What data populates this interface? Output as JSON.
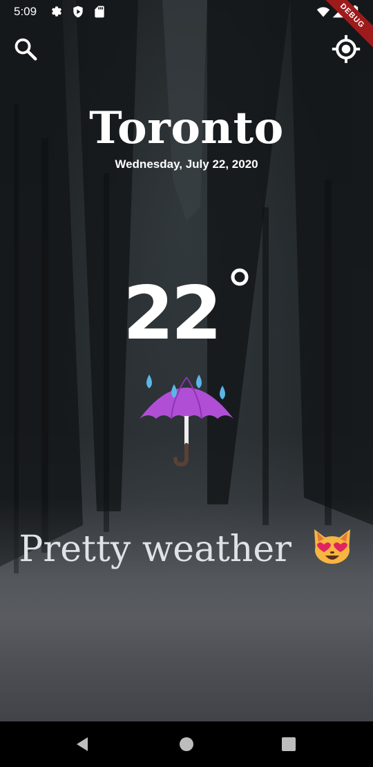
{
  "status_bar": {
    "time": "5:09",
    "debug_label": "DEBUG",
    "icons": [
      "settings-icon",
      "shield-icon",
      "sd-card-icon",
      "wifi-icon",
      "signal-icon",
      "battery-icon"
    ]
  },
  "toolbar": {
    "search_icon": "search-icon",
    "location_icon": "my-location-icon"
  },
  "weather": {
    "city": "Toronto",
    "date": "Wednesday, July 22, 2020",
    "temperature": "22",
    "degree_symbol": "°",
    "condition_icon": "umbrella-rain-icon",
    "message": "Pretty weather",
    "message_emoji": "cat-heart-eyes-icon"
  },
  "nav_bar": {
    "buttons": [
      "back-icon",
      "home-icon",
      "recents-icon"
    ]
  },
  "colors": {
    "debug_banner": "#9e1b1b",
    "umbrella": "#b04fd6",
    "rain_drop": "#5bb6e6",
    "message_text": "#dfe3e6"
  }
}
